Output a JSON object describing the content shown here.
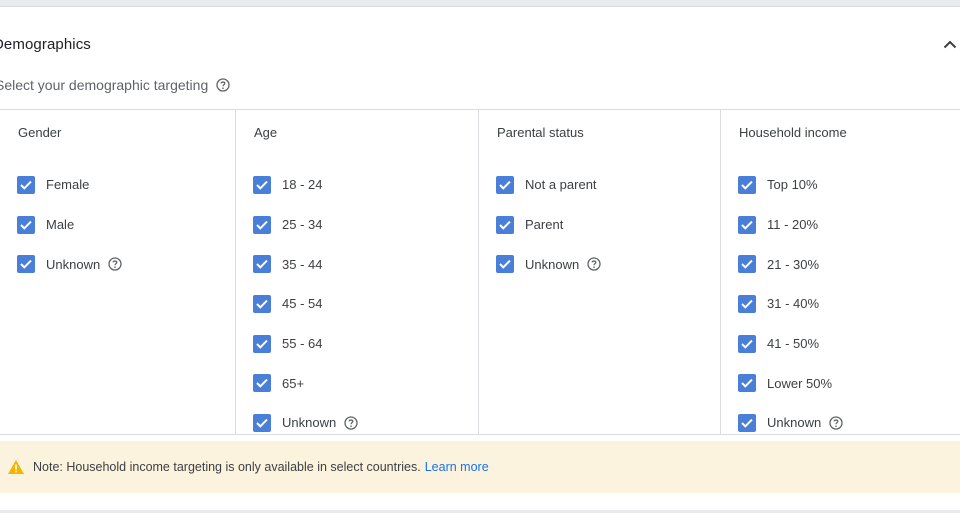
{
  "section": {
    "title": "Demographics",
    "subtitle": "Select your demographic targeting"
  },
  "colors": {
    "checkbox": "#4a7fd9",
    "link": "#1a73e8",
    "note_bg": "#fcf3de",
    "warning": "#f4b400"
  },
  "columns": [
    {
      "heading": "Gender",
      "options": [
        {
          "label": "Female",
          "checked": true
        },
        {
          "label": "Male",
          "checked": true
        },
        {
          "label": "Unknown",
          "checked": true,
          "help": true
        }
      ]
    },
    {
      "heading": "Age",
      "options": [
        {
          "label": "18 - 24",
          "checked": true
        },
        {
          "label": "25 - 34",
          "checked": true
        },
        {
          "label": "35 - 44",
          "checked": true
        },
        {
          "label": "45 - 54",
          "checked": true
        },
        {
          "label": "55 - 64",
          "checked": true
        },
        {
          "label": "65+",
          "checked": true
        },
        {
          "label": "Unknown",
          "checked": true,
          "help": true
        }
      ]
    },
    {
      "heading": "Parental status",
      "options": [
        {
          "label": "Not a parent",
          "checked": true
        },
        {
          "label": "Parent",
          "checked": true
        },
        {
          "label": "Unknown",
          "checked": true,
          "help": true
        }
      ]
    },
    {
      "heading": "Household income",
      "options": [
        {
          "label": "Top 10%",
          "checked": true
        },
        {
          "label": "11 - 20%",
          "checked": true
        },
        {
          "label": "21 - 30%",
          "checked": true
        },
        {
          "label": "31 - 40%",
          "checked": true
        },
        {
          "label": "41 - 50%",
          "checked": true
        },
        {
          "label": "Lower 50%",
          "checked": true
        },
        {
          "label": "Unknown",
          "checked": true,
          "help": true
        }
      ]
    }
  ],
  "note": {
    "text": "Note: Household income targeting is only available in select countries.",
    "link": "Learn more"
  },
  "icons": {
    "collapse": "chevron-up-icon",
    "help": "help-circle-icon",
    "warning": "warning-triangle-icon",
    "check": "check-icon"
  }
}
